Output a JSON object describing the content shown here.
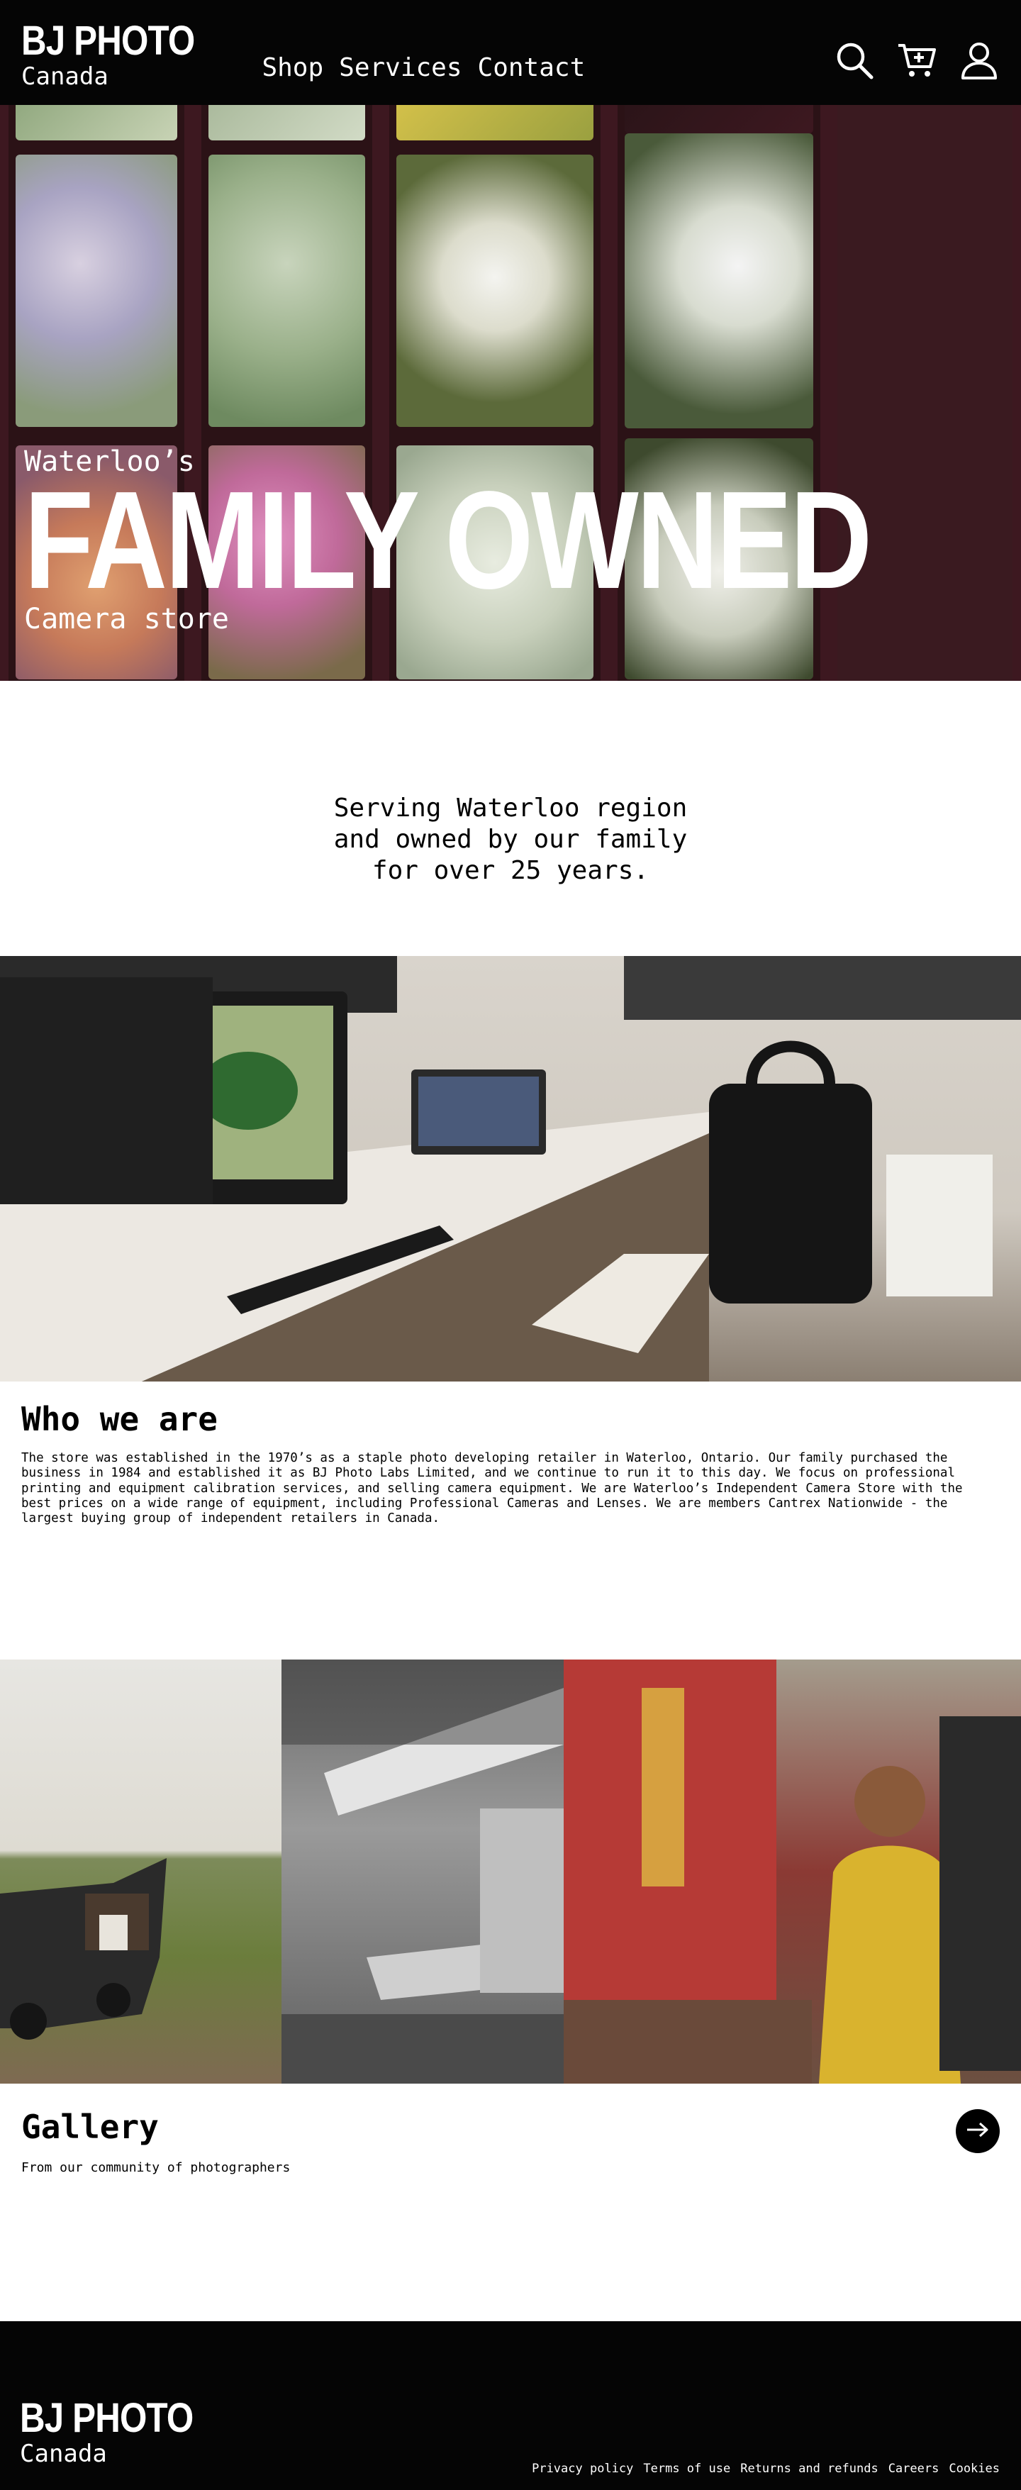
{
  "header": {
    "brand_name": "BJ PHOTO",
    "brand_sub": "Canada",
    "nav": [
      "Shop",
      "Services",
      "Contact"
    ],
    "icons": [
      "search-icon",
      "cart-add-icon",
      "user-icon"
    ]
  },
  "hero": {
    "kicker": "Waterloo’s",
    "title": "FAMILY OWNED",
    "subtitle": "Camera store"
  },
  "serving": {
    "text": "Serving Waterloo region and owned by our family for over 25 years."
  },
  "who": {
    "title": "Who we are",
    "body": "The store was established in the 1970’s as a staple photo developing retailer in Waterloo, Ontario. Our family purchased the business in 1984 and established it as BJ Photo Labs Limited, and we continue to run it to this day. We focus on professional printing and equipment calibration services, and selling camera equipment. We are Waterloo’s Independent Camera Store with the best prices on a wide range of equipment, including Professional Cameras and Lenses. We are members Cantrex Nationwide - the largest buying group of independent retailers in Canada."
  },
  "gallery": {
    "title": "Gallery",
    "subtitle": "From our community of photographers",
    "arrow_icon": "arrow-right-icon"
  },
  "footer": {
    "brand_name": "BJ PHOTO",
    "brand_sub": "Canada",
    "links": [
      "Privacy policy",
      "Terms of use",
      "Returns and refunds",
      "Careers",
      "Cookies"
    ]
  },
  "colors": {
    "header_bg": "#050505",
    "film_border": "#3d1820"
  }
}
